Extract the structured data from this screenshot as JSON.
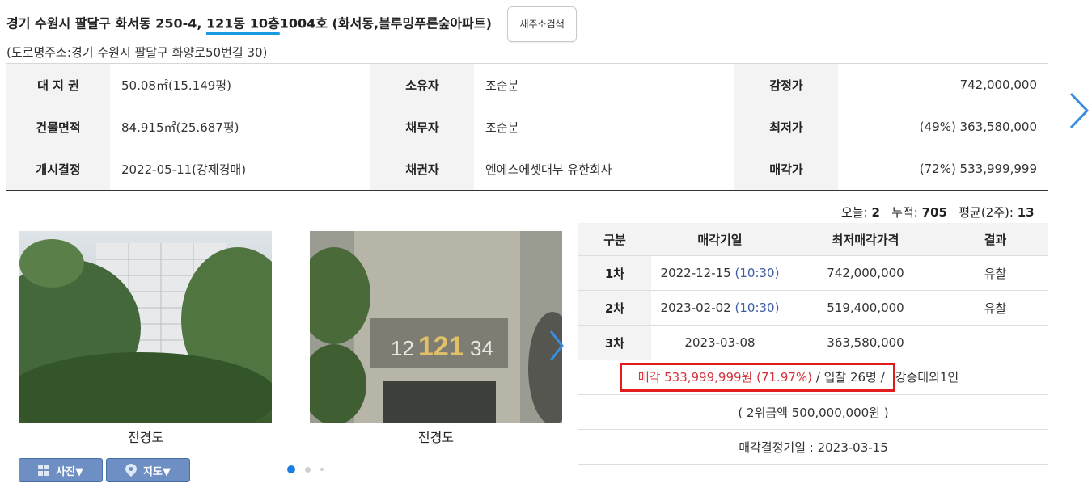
{
  "header": {
    "address_prefix": "경기 수원시 팔달구 화서동 250-4, ",
    "address_unit": "121동 10층",
    "address_suffix": "1004호 (화서동,블루밍푸른숲아파트)",
    "new_address_button": "새주소검색",
    "road_address": "(도로명주소:경기 수원시 팔달구 화양로50번길 30)"
  },
  "info": {
    "rows": [
      {
        "l1": "대 지 권",
        "v1": "50.08㎡(15.149평)",
        "l2": "소유자",
        "v2": "조순분",
        "l3": "감정가",
        "v3": "742,000,000"
      },
      {
        "l1": "건물면적",
        "v1": "84.915㎡(25.687평)",
        "l2": "채무자",
        "v2": "조순분",
        "l3": "최저가",
        "v3": "(49%) 363,580,000"
      },
      {
        "l1": "개시결정",
        "v1": "2022-05-11(강제경매)",
        "l2": "채권자",
        "v2": "엔에스에셋대부 유한회사",
        "l3": "매각가",
        "v3": "(72%) 533,999,999"
      }
    ]
  },
  "stats": {
    "today_label": "오늘:",
    "today": "2",
    "total_label": "누적:",
    "total": "705",
    "avg_label": "평균(2주):",
    "avg": "13"
  },
  "photos": {
    "captions": [
      "전경도",
      "전경도"
    ],
    "sign_left": "12",
    "sign_main": "121",
    "sign_right": "34"
  },
  "tools": {
    "photo_button": "사진▼",
    "map_button": "지도▼",
    "photo_icon": "grid-icon",
    "map_icon": "map-pin-icon"
  },
  "carousel": {
    "current_page": 1,
    "page_count": 3
  },
  "bid_table": {
    "headers": [
      "구분",
      "매각기일",
      "최저매각가격",
      "결과"
    ],
    "rows": [
      {
        "round": "1차",
        "date": "2022-12-15",
        "time": "(10:30)",
        "price": "742,000,000",
        "result": "유찰"
      },
      {
        "round": "2차",
        "date": "2023-02-02",
        "time": "(10:30)",
        "price": "519,400,000",
        "result": "유찰"
      },
      {
        "round": "3차",
        "date": "2023-03-08",
        "time": "",
        "price": "363,580,000",
        "result": ""
      }
    ],
    "sale_result": "매각 533,999,999원 (71.97%)",
    "bidders": " / 입찰 26명 / ",
    "winner": "강승태외1인",
    "second_bid": "( 2위금액 500,000,000원 )",
    "decision_date": "매각결정기일 : 2023-03-15"
  },
  "colors": {
    "accent_blue": "#3b5ba5",
    "accent_red": "#d2343c",
    "highlight_box": "#e21b1b",
    "tool_button": "#6d8fc4"
  }
}
